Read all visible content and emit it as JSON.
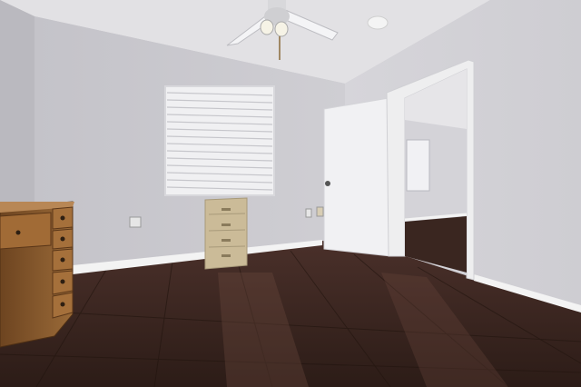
{
  "photo": {
    "subject": "empty-bedroom",
    "colors": {
      "ceiling": "#e4e3e6",
      "wall_back": "#c8c7cc",
      "wall_left": "#bdbcc2",
      "wall_right": "#d2d1d6",
      "floor": "#3a2620",
      "trim": "#f2f2f2",
      "door": "#f1f1f3",
      "desk_wood": "#8a5a2e",
      "file_cabinet": "#cdbd9c",
      "blinds": "#e9e9ec"
    },
    "objects": [
      "ceiling-fan",
      "window-with-blinds",
      "filing-cabinet",
      "wooden-desk",
      "open-door",
      "doorway-next-room",
      "hardwood-floor",
      "smoke-detector"
    ]
  }
}
